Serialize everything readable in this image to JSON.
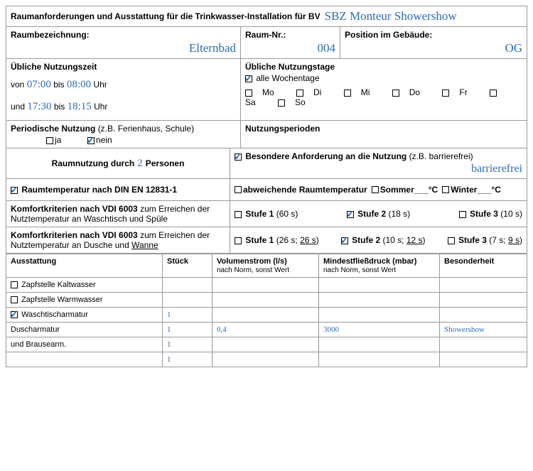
{
  "header": {
    "title_prefix": "Raumanforderungen und Ausstattung für die Trinkwasser-Installation für BV",
    "bv_name": "SBZ Monteur Showershow"
  },
  "room": {
    "label_bez": "Raumbezeichnung:",
    "bez": "Elternbad",
    "label_nr": "Raum-Nr.:",
    "nr": "004",
    "label_pos": "Position im Gebäude:",
    "pos": "OG"
  },
  "usage_time": {
    "label": "Übliche Nutzungszeit",
    "from1_label": "von",
    "from1": "07:00",
    "to1_label": "bis",
    "to1": "08:00",
    "uhr": "Uhr",
    "and": "und",
    "from2": "17:30",
    "to2": "18:15"
  },
  "usage_days": {
    "label": "Übliche Nutzungstage",
    "all": "alle Wochentage",
    "days": [
      "Mo",
      "Di",
      "Mi",
      "Do",
      "Fr",
      "Sa",
      "So"
    ]
  },
  "periodic": {
    "label": "Periodische Nutzung",
    "hint": "(z.B. Ferienhaus, Schule)",
    "ja": "ja",
    "nein": "nein"
  },
  "periods": {
    "label": "Nutzungsperioden"
  },
  "persons": {
    "prefix": "Raumnutzung durch",
    "count": "2",
    "suffix": "Personen"
  },
  "special": {
    "label": "Besondere Anforderung an die Nutzung",
    "hint": "(z.B. barrierefrei)",
    "value": "barrierefrei"
  },
  "temp": {
    "din": "Raumtemperatur nach DIN EN 12831-1",
    "abw": "abweichende Raumtemperatur",
    "sommer": "Sommer___°C",
    "winter": "Winter___°C"
  },
  "comfort1": {
    "label": "Komfortkriterien nach VDI 6003",
    "sub": "zum Erreichen der Nutztemperatur an Waschtisch und Spüle",
    "s1": "Stufe 1",
    "s1t": "(60 s)",
    "s2": "Stufe 2",
    "s2t": "(18 s)",
    "s3": "Stufe 3",
    "s3t": "(10 s)"
  },
  "comfort2": {
    "label": "Komfortkriterien nach VDI 6003",
    "sub": "zum Erreichen der Nutztemperatur an Dusche und ",
    "sub_u": "Wanne",
    "s1": "Stufe 1",
    "s1t_a": "(26 s; ",
    "s1t_b": "26 s",
    "s1t_c": ")",
    "s2": "Stufe 2",
    "s2t_a": "(10 s; ",
    "s2t_b": "12 s",
    "s2t_c": ")",
    "s3": "Stufe 3",
    "s3t_a": "(7 s; ",
    "s3t_b": "9 s",
    "s3t_c": ")"
  },
  "equip": {
    "headers": {
      "ausst": "Ausstattung",
      "stk": "Stück",
      "vol": "Volumenstrom (l/s)",
      "vol_sub": "nach Norm, sonst Wert",
      "druck": "Mindestfließdruck (mbar)",
      "druck_sub": "nach Norm, sonst Wert",
      "bes": "Besonderheit"
    },
    "rows": [
      {
        "name": "Zapfstelle Kaltwasser",
        "checked": false,
        "stk": "",
        "vol": "",
        "druck": "",
        "bes": ""
      },
      {
        "name": "Zapfstelle Warmwasser",
        "checked": false,
        "stk": "",
        "vol": "",
        "druck": "",
        "bes": ""
      },
      {
        "name": "Waschtischarmatur",
        "checked": true,
        "stk": "1",
        "vol": "",
        "druck": "",
        "bes": ""
      },
      {
        "name": "Duscharmatur",
        "checked": null,
        "stk": "1",
        "vol": "0,4",
        "druck": "3000",
        "bes": "Showershow"
      },
      {
        "name": "und Brausearm.",
        "checked": null,
        "stk": "1",
        "vol": "",
        "druck": "",
        "bes": ""
      },
      {
        "name": "",
        "checked": null,
        "stk": "1",
        "vol": "",
        "druck": "",
        "bes": ""
      }
    ]
  }
}
